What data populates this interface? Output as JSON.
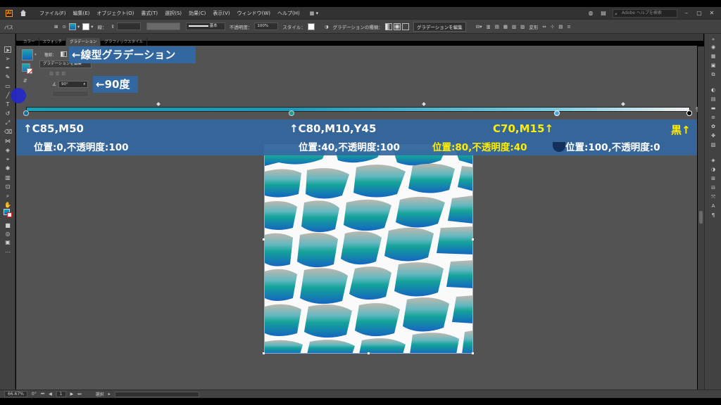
{
  "app": {
    "logo_text": "Ai",
    "menu": [
      "ファイル(F)",
      "編集(E)",
      "オブジェクト(O)",
      "書式(T)",
      "選択(S)",
      "効果(C)",
      "表示(V)",
      "ウィンドウ(W)",
      "ヘルプ(H)"
    ],
    "workspace": "▦ ▾",
    "search_placeholder": "Adobe ヘルプを検索"
  },
  "control_bar": {
    "path_label": "パス",
    "stroke_label": "線：",
    "stroke_style": "基本",
    "opacity_label": "不透明度：",
    "opacity_value": "100%",
    "style_label": "スタイル：",
    "gradient_type_label": "グラデーションの種類：",
    "edit_gradient_button": "グラデーションを編集",
    "transform_label": "変形"
  },
  "panel_tabs": [
    "カラー",
    "スウォッチ",
    "グラデーション",
    "グラフィックスタイル"
  ],
  "gradient_panel": {
    "type_label": "種類：",
    "edit_button": "グラデーションを編集",
    "angle_value": "90°"
  },
  "annotations": {
    "linear": "←線型グラデーション",
    "angle": "←90度",
    "stop1_color": "↑C85,M50",
    "stop1_info": "位置:0,不透明度:100",
    "stop2_color": "↑C80,M10,Y45",
    "stop2_info": "位置:40,不透明度:100",
    "stop3_color": "C70,M15↑",
    "stop3_info": "位置:80,不透明度:40",
    "stop4_color": "黒↑",
    "stop4_info": "位置:100,不透明度:0"
  },
  "status_bar": {
    "zoom": "66.67%",
    "rotation": "0°",
    "artboard": "1",
    "tool": "選択"
  },
  "colors": {
    "annotation_bg": "#33679f",
    "annotation_yellow": "#ffee00",
    "gradient_start": "#15a0b3",
    "gradient_end": "#f0f0f0"
  }
}
